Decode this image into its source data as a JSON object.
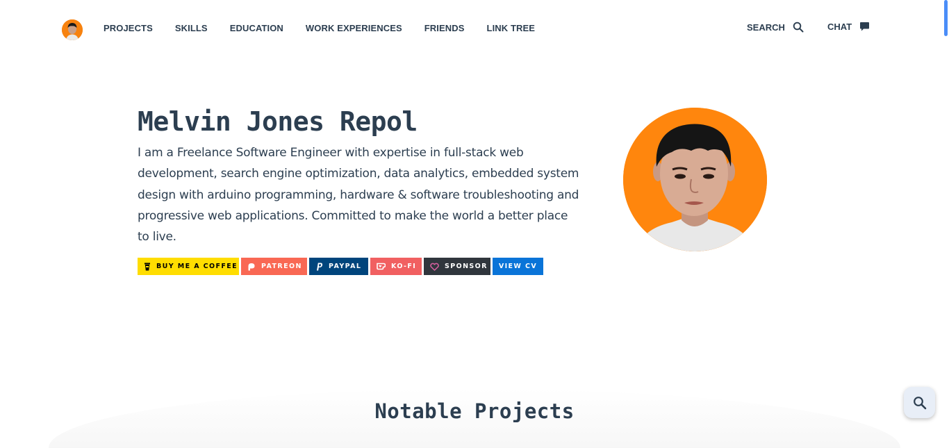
{
  "nav": {
    "links": [
      {
        "label": "PROJECTS"
      },
      {
        "label": "SKILLS"
      },
      {
        "label": "EDUCATION"
      },
      {
        "label": "WORK EXPERIENCES"
      },
      {
        "label": "FRIENDS"
      },
      {
        "label": "LINK TREE"
      }
    ],
    "search_label": "SEARCH",
    "chat_label": "CHAT",
    "search_icon": "search-icon",
    "chat_icon": "chat-bubble-icon"
  },
  "hero": {
    "name": "Melvin Jones Repol",
    "bio": "I am a Freelance Software Engineer with expertise in full-stack web development, search engine optimization, data analytics, embedded system design with arduino programming, hardware & software troubleshooting and progressive web applications. Committed to make the world a better place to live.",
    "badges": [
      {
        "label": "BUY ME A COFFEE",
        "icon": "coffee-cup-icon",
        "color": "#ffdd00"
      },
      {
        "label": "PATREON",
        "icon": "patreon-icon",
        "color": "#f96854"
      },
      {
        "label": "PAYPAL",
        "icon": "paypal-icon",
        "color": "#00457c"
      },
      {
        "label": "KO-FI",
        "icon": "ko-fi-icon",
        "color": "#f16061"
      },
      {
        "label": "SPONSOR",
        "icon": "heart-icon",
        "color": "#30363d"
      },
      {
        "label": "VIEW CV",
        "color": "#0a74d8"
      }
    ]
  },
  "sections": {
    "notable_projects_title": "Notable Projects"
  },
  "fab": {
    "icon": "search-icon"
  },
  "colors": {
    "text": "#2c3e50",
    "accent_orange": "#ff860d",
    "link_blue": "#0a74d8"
  }
}
